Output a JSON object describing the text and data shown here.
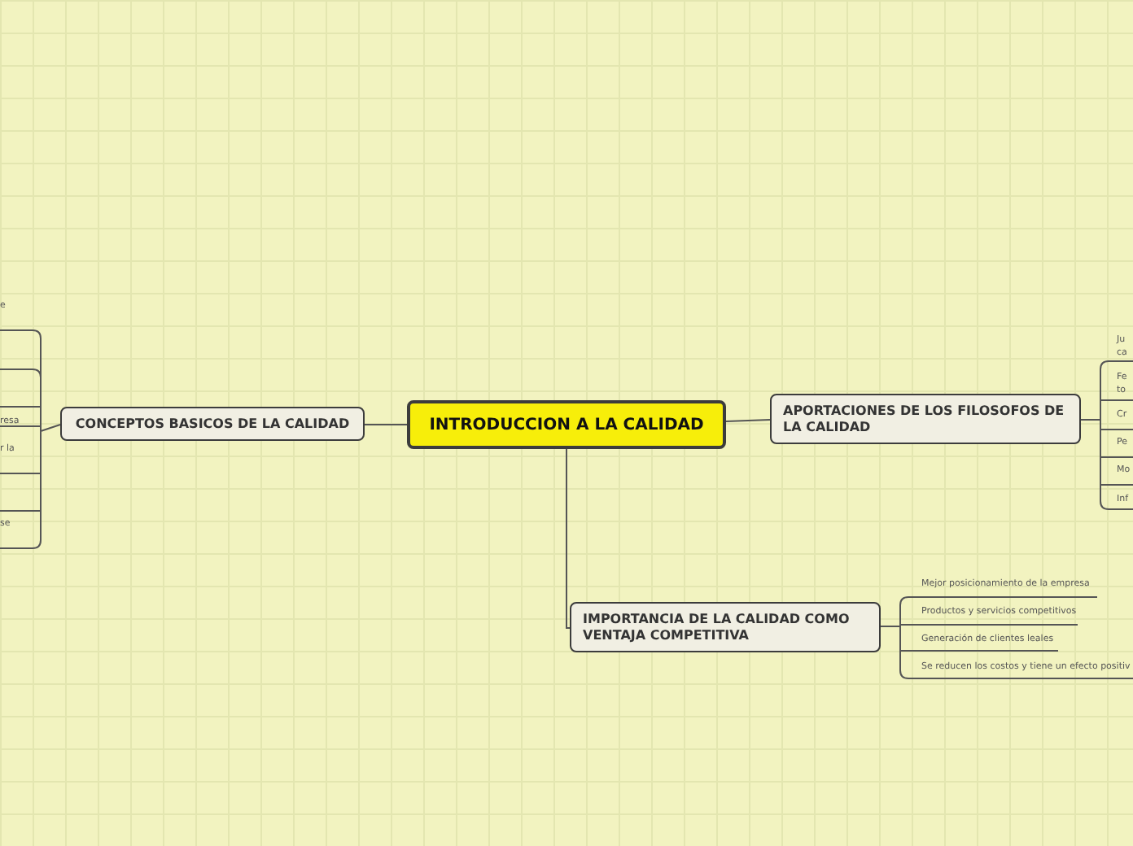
{
  "central_topic": {
    "title": "INTRODUCCION A LA CALIDAD"
  },
  "branches": [
    {
      "kind": "left",
      "title": "CONCEPTOS BASICOS DE LA CALIDAD",
      "subtopics": [
        {
          "lines": [
            "e"
          ]
        },
        {
          "lines": [
            "resa"
          ]
        },
        {
          "lines": [
            "r la"
          ]
        },
        {
          "lines": [
            "se"
          ]
        }
      ]
    },
    {
      "kind": "right",
      "title": "APORTACIONES DE LOS FILOSOFOS DE LA CALIDAD",
      "subtopics": [
        {
          "lines": [
            "Ju",
            "ca"
          ]
        },
        {
          "lines": [
            "Fe",
            "to"
          ]
        },
        {
          "lines": [
            "Cr"
          ]
        },
        {
          "lines": [
            "Pe"
          ]
        },
        {
          "lines": [
            "Mo"
          ]
        },
        {
          "lines": [
            "Inf"
          ]
        }
      ]
    },
    {
      "kind": "bottom",
      "title": "IMPORTANCIA DE LA CALIDAD COMO VENTAJA COMPETITIVA",
      "subtopics": [
        {
          "lines": [
            "Mejor posicionamiento de la empresa"
          ]
        },
        {
          "lines": [
            "Productos y servicios competitivos"
          ]
        },
        {
          "lines": [
            "Generación de clientes leales"
          ]
        },
        {
          "lines": [
            "Se reducen los costos y tiene un efecto positiv"
          ]
        }
      ]
    }
  ]
}
